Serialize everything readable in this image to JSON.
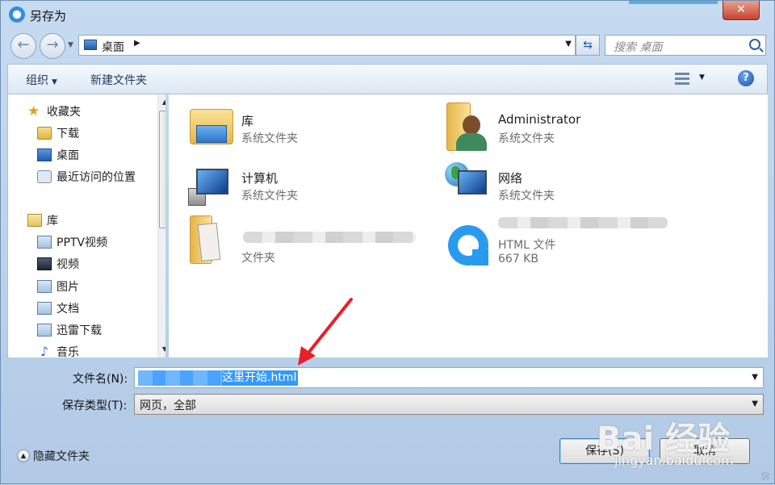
{
  "window": {
    "title": "另存为",
    "close_glyph": "✕"
  },
  "address": {
    "current": "桌面",
    "search_placeholder": "搜索 桌面"
  },
  "toolbar": {
    "organize": "组织",
    "new_folder": "新建文件夹",
    "help": "?"
  },
  "sidebar": {
    "items": [
      {
        "label": "收藏夹",
        "icon": "star-icon"
      },
      {
        "label": "下载",
        "icon": "download-folder-icon"
      },
      {
        "label": "桌面",
        "icon": "desktop-icon"
      },
      {
        "label": "最近访问的位置",
        "icon": "recent-places-icon"
      },
      {
        "label": "库",
        "icon": "library-icon"
      },
      {
        "label": "PPTV视频",
        "icon": "library-folder-icon"
      },
      {
        "label": "视频",
        "icon": "video-icon"
      },
      {
        "label": "图片",
        "icon": "pictures-icon"
      },
      {
        "label": "文档",
        "icon": "documents-icon"
      },
      {
        "label": "迅雷下载",
        "icon": "library-folder-icon"
      },
      {
        "label": "音乐",
        "icon": "music-icon"
      }
    ]
  },
  "files": [
    {
      "name": "库",
      "type": "系统文件夹",
      "icon": "library-folder-icon"
    },
    {
      "name": "Administrator",
      "type": "系统文件夹",
      "icon": "user-folder-icon"
    },
    {
      "name": "计算机",
      "type": "系统文件夹",
      "icon": "computer-icon"
    },
    {
      "name": "网络",
      "type": "系统文件夹",
      "icon": "network-icon"
    },
    {
      "name": "",
      "type": "文件夹",
      "icon": "photo-folder-icon"
    },
    {
      "name": "",
      "type": "HTML 文件",
      "size": "667 KB",
      "icon": "browser-html-icon"
    }
  ],
  "form": {
    "filename_label": "文件名(N):",
    "filename_value": "这里开始.html",
    "filetype_label": "保存类型(T):",
    "filetype_value": "网页，全部"
  },
  "footer": {
    "hide_folders": "隐藏文件夹",
    "save": "保存(S)",
    "cancel": "取消"
  },
  "watermark": {
    "brand": "Bai 经验",
    "url": "jingyan.baidu.com"
  },
  "colors": {
    "selection": "#3399ff",
    "annotation_arrow": "#e8202a"
  }
}
